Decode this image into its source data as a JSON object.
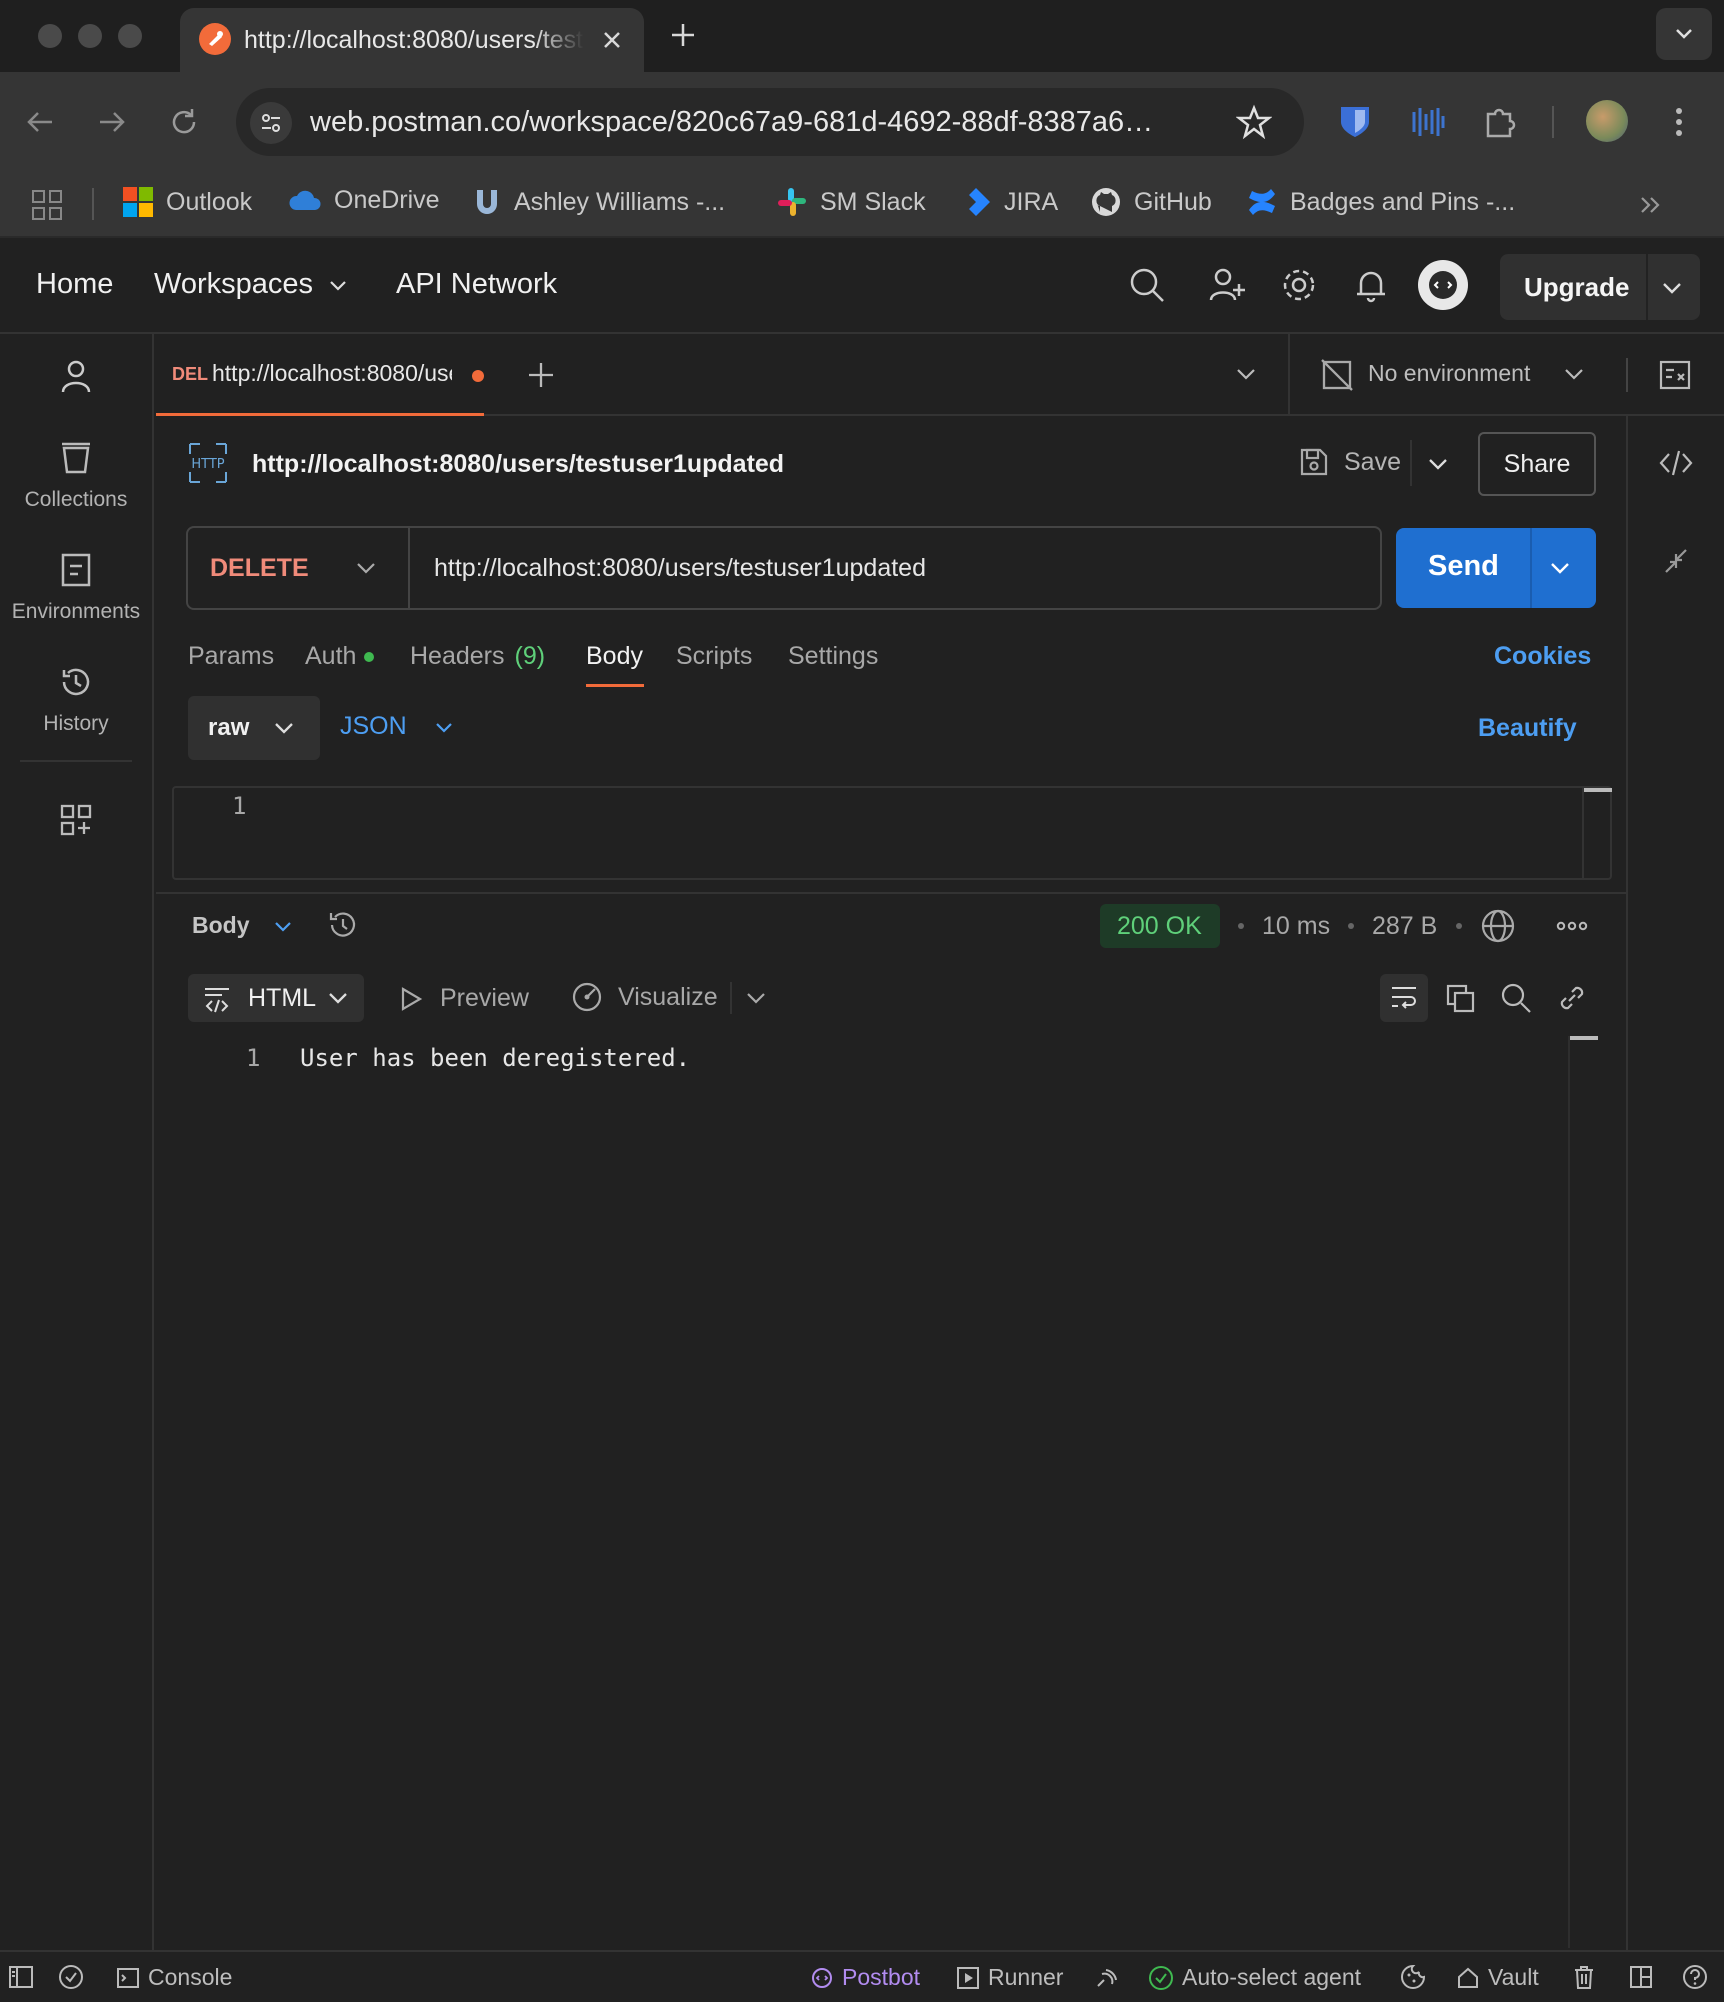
{
  "browser": {
    "tab_title": "http://localhost:8080/users/testuser1updated",
    "address": "web.postman.co/workspace/820c67a9-681d-4692-88df-8387a6…",
    "bookmarks": [
      "Outlook",
      "OneDrive",
      "Ashley Williams -...",
      "SM Slack",
      "JIRA",
      "GitHub",
      "Badges and Pins -..."
    ]
  },
  "header": {
    "home": "Home",
    "workspaces": "Workspaces",
    "api_network": "API Network",
    "upgrade": "Upgrade"
  },
  "sidebar": {
    "items": [
      {
        "label": "Collections",
        "icon": "collections-icon"
      },
      {
        "label": "Environments",
        "icon": "environments-icon"
      },
      {
        "label": "History",
        "icon": "history-icon"
      }
    ]
  },
  "request_tab": {
    "method": "DEL",
    "url": "http://localhost:8080/users/testuser1updated"
  },
  "environment": {
    "label": "No environment"
  },
  "request": {
    "title": "http://localhost:8080/users/testuser1updated",
    "save": "Save",
    "share": "Share",
    "method": "DELETE",
    "url": "http://localhost:8080/users/testuser1updated",
    "send": "Send",
    "tabs": {
      "params": "Params",
      "auth": "Auth",
      "headers": "Headers",
      "headers_count": "(9)",
      "body": "Body",
      "scripts": "Scripts",
      "settings": "Settings"
    },
    "cookies": "Cookies",
    "body_mode": "raw",
    "body_format": "JSON",
    "beautify": "Beautify",
    "editor_line": "1"
  },
  "response": {
    "view": "Body",
    "status": "200 OK",
    "time": "10 ms",
    "size": "287 B",
    "format": "HTML",
    "preview": "Preview",
    "visualize": "Visualize",
    "line_number": "1",
    "content": "User has been deregistered."
  },
  "footer": {
    "console": "Console",
    "postbot": "Postbot",
    "runner": "Runner",
    "agent": "Auto-select agent",
    "vault": "Vault"
  },
  "colors": {
    "accent_orange": "#f26b3a",
    "send_blue": "#1f6fd0",
    "link_blue": "#4d9ef2",
    "status_green": "#5fd07a",
    "delete_red": "#f08b7a"
  }
}
